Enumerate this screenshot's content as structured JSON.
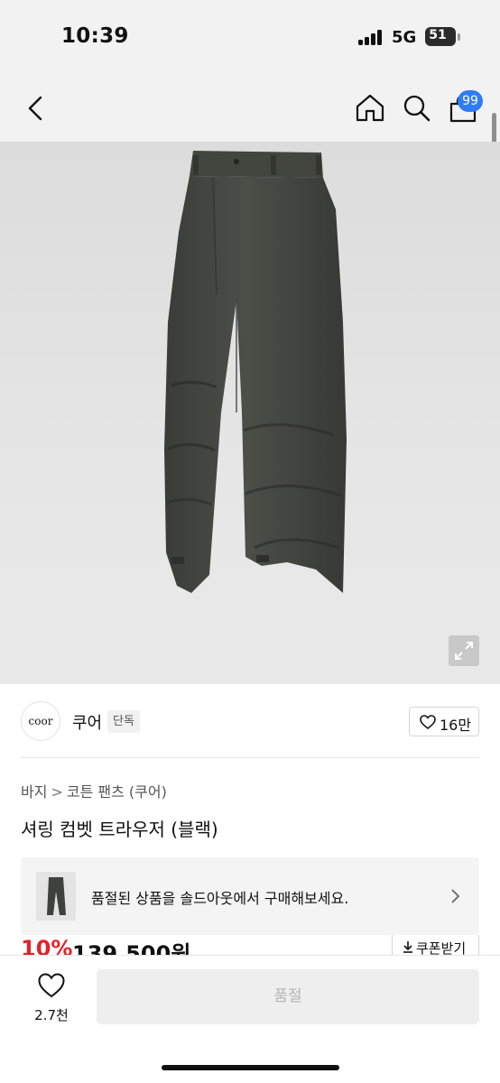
{
  "status_bar": {
    "time": "10:39",
    "network": "5G",
    "battery": "51"
  },
  "nav": {
    "cart_badge": "99",
    "icons": [
      "chevron-left-icon",
      "home-icon",
      "search-icon",
      "shopping-bag-icon"
    ]
  },
  "brand": {
    "logo_text": "coor",
    "name": "쿠어",
    "tag": "단독",
    "likes": "16만"
  },
  "breadcrumb": [
    "바지",
    "코튼 팬츠 (쿠어)"
  ],
  "product": {
    "title": "셔링 컴벳 트라우저 (블랙)"
  },
  "soldout_banner": {
    "text": "품절된 상품을 솔드아웃에서 구매해보세요."
  },
  "price": {
    "discount": "10%",
    "amount": "139,500원",
    "coupon_label": "쿠폰받기"
  },
  "bottom_bar": {
    "wish_count": "2.7천",
    "buy_label": "품절"
  },
  "colors": {
    "accent_badge": "#2f7cf6",
    "discount_red": "#e3222d",
    "disabled_button": "#eeeeee"
  }
}
